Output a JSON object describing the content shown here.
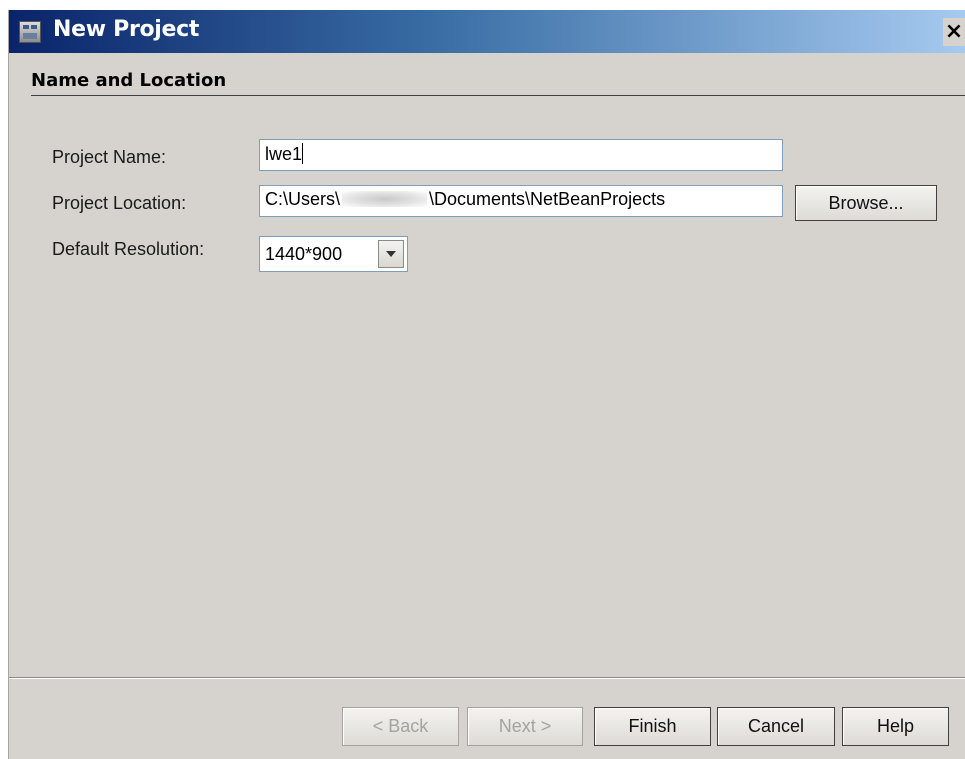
{
  "window": {
    "title": "New Project",
    "close_label": "×"
  },
  "section": {
    "title": "Name and Location"
  },
  "form": {
    "project_name": {
      "label": "Project Name:",
      "value": "lwe1"
    },
    "project_location": {
      "label": "Project Location:",
      "value_prefix": "C:\\Users\\",
      "value_suffix": "\\Documents\\NetBeanProjects",
      "browse_label": "Browse..."
    },
    "default_resolution": {
      "label": "Default Resolution:",
      "selected": "1440*900"
    }
  },
  "buttons": {
    "back": "< Back",
    "next": "Next >",
    "finish": "Finish",
    "cancel": "Cancel",
    "help": "Help"
  },
  "icons": {
    "app": "application-icon",
    "close": "close-icon",
    "dropdown": "chevron-down-icon"
  },
  "colors": {
    "titlebar_start": "#0a246a",
    "titlebar_end": "#a6caf0",
    "dialog_background": "#d6d3ce"
  }
}
